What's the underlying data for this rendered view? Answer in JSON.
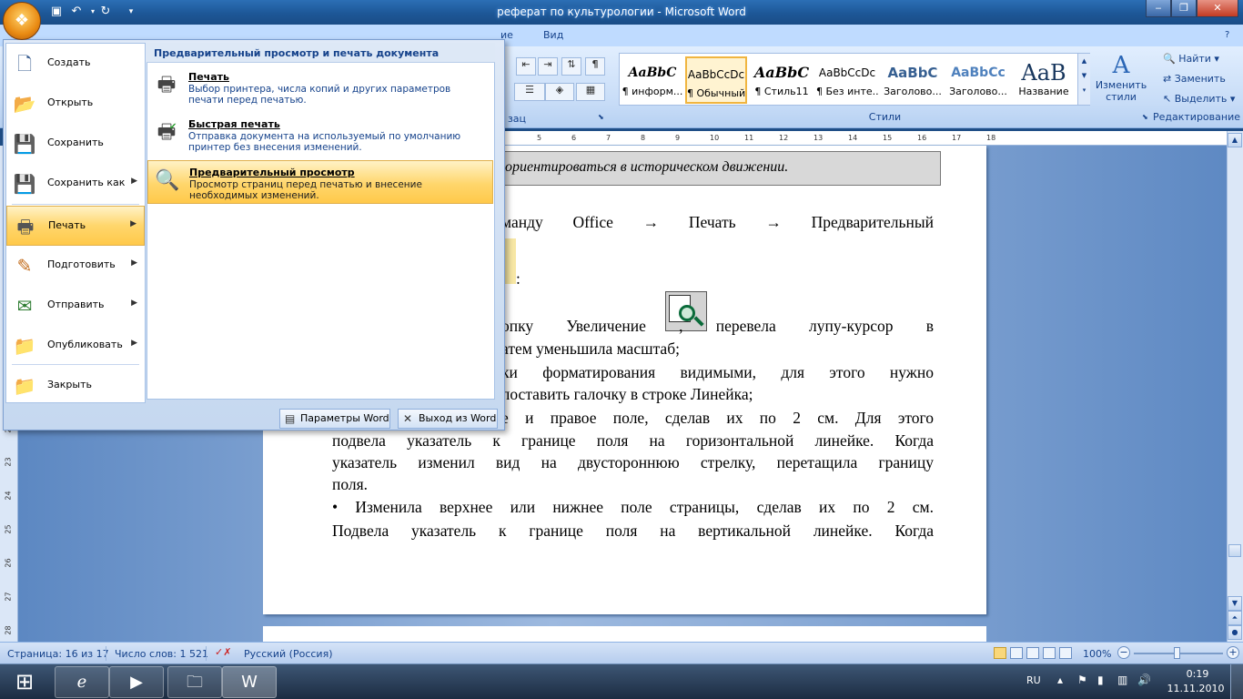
{
  "window": {
    "title": "реферат по культурологии - Microsoft Word"
  },
  "ribbon": {
    "tabs": [
      "ие",
      "Вид"
    ],
    "styles_group_label": "Стили",
    "paragraph_group_label": "зац",
    "styles": [
      {
        "sample": "AaBbC",
        "name": "¶ информ..."
      },
      {
        "sample": "AaBbCcDc",
        "name": "¶ Обычный"
      },
      {
        "sample": "AaBbC",
        "name": "¶ Стиль11"
      },
      {
        "sample": "AaBbCcDc",
        "name": "¶ Без инте..."
      },
      {
        "sample": "AaBbC",
        "name": "Заголово..."
      },
      {
        "sample": "AaBbCc",
        "name": "Заголово..."
      },
      {
        "sample": "AaB",
        "name": "Название"
      }
    ],
    "change_styles_label": "Изменить стили",
    "editing": {
      "group_label": "Редактирование",
      "find": "Найти",
      "replace": "Заменить",
      "select": "Выделить"
    }
  },
  "ruler": {
    "h_ticks": [
      "5",
      "6",
      "7",
      "8",
      "9",
      "10",
      "11",
      "12",
      "13",
      "14",
      "15",
      "16",
      "17",
      "18"
    ],
    "v_ticks": [
      "22",
      "23",
      "24",
      "25",
      "26",
      "27",
      "28"
    ]
  },
  "document": {
    "quote": "ориентироваться в историческом движении.",
    "lines": [
      "манду Office → Печать → Предварительный",
      ":",
      "опку Увеличение , перевела лупу-курсор в",
      "атем уменьшила масштаб;",
      "ки форматирования видимыми, для этого нужно",
      "поставить галочку в строке Линейка;",
      "е и правое поле, сделав их по 2 см. Для этого",
      "подвела указатель к границе поля на горизонтальной линейке. Когда",
      "указатель изменил вид на двустороннюю стрелку, перетащила границу",
      "поля.",
      "•      Изменила верхнее или нижнее поле страницы, сделав их по 2 см.",
      "Подвела указатель к границе поля на вертикальной линейке. Когда"
    ]
  },
  "office_menu": {
    "items": [
      {
        "label": "Создать",
        "icon": "new-document-icon",
        "glyph": "🗋"
      },
      {
        "label": "Открыть",
        "icon": "open-folder-icon",
        "glyph": "📂"
      },
      {
        "label": "Сохранить",
        "icon": "save-icon",
        "glyph": "💾"
      },
      {
        "label": "Сохранить как",
        "icon": "save-as-icon",
        "glyph": "💾"
      },
      {
        "label": "Печать",
        "icon": "printer-icon",
        "glyph": "🖶"
      },
      {
        "label": "Подготовить",
        "icon": "prepare-icon",
        "glyph": "✎"
      },
      {
        "label": "Отправить",
        "icon": "send-icon",
        "glyph": "✉"
      },
      {
        "label": "Опубликовать",
        "icon": "publish-icon",
        "glyph": "📁"
      },
      {
        "label": "Закрыть",
        "icon": "close-folder-icon",
        "glyph": "📁"
      }
    ],
    "submenu": {
      "title": "Предварительный просмотр и печать документа",
      "items": [
        {
          "title": "Печать",
          "desc": "Выбор принтера, числа копий и других параметров печати перед печатью."
        },
        {
          "title": "Быстрая печать",
          "desc": "Отправка документа на используемый по умолчанию принтер без внесения изменений."
        },
        {
          "title": "Предварительный просмотр",
          "desc": "Просмотр страниц перед печатью и внесение необходимых изменений."
        }
      ]
    },
    "footer": {
      "options": "Параметры Word",
      "exit": "Выход из Word"
    }
  },
  "statusbar": {
    "page": "Страница: 16 из 17",
    "words": "Число слов: 1 521",
    "language": "Русский (Россия)",
    "zoom": "100%"
  },
  "taskbar": {
    "lang": "RU",
    "time": "0:19",
    "date": "11.11.2010"
  },
  "colors": {
    "accent": "#15428b",
    "highlight": "#ffd66c",
    "office_orb": "#e98a12"
  }
}
